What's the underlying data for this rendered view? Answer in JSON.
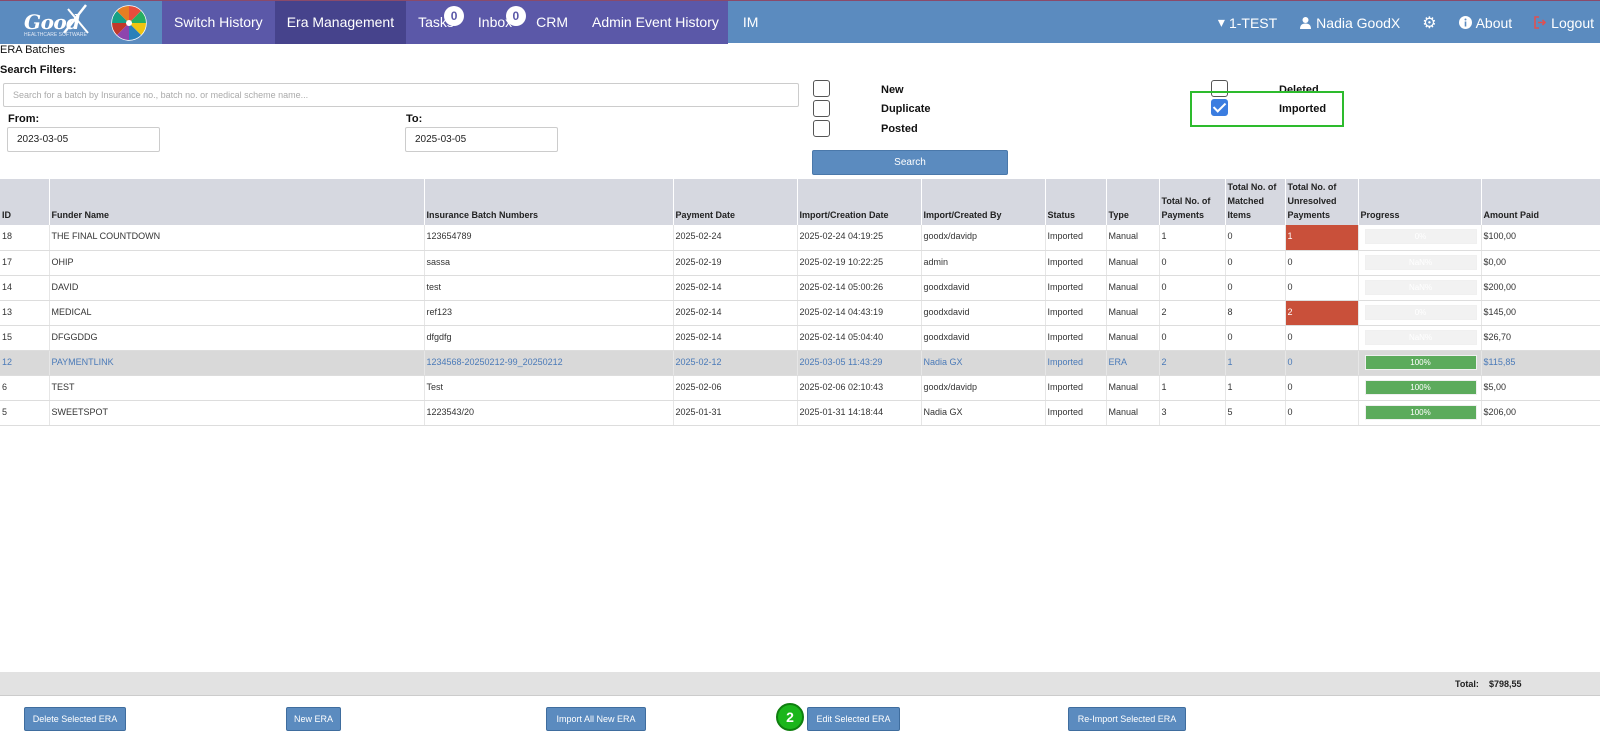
{
  "nav": {
    "logo_text": "Good",
    "logo_sub": "HEALTHCARE SOFTWARE",
    "items": [
      {
        "label": "Switch History"
      },
      {
        "label": "Era Management"
      },
      {
        "label": "Tasks",
        "badge": "0"
      },
      {
        "label": "Inbox",
        "badge": "0"
      },
      {
        "label": "CRM"
      },
      {
        "label": "Admin Event History"
      },
      {
        "label": "IM"
      }
    ],
    "right": {
      "practice": "1-TEST",
      "user": "Nadia GoodX",
      "about": "About",
      "logout": "Logout"
    },
    "colors": {
      "bar": "#5b8bbf",
      "menu": "#5b58a8",
      "active": "#46438c"
    }
  },
  "page": {
    "title": "ERA Batches",
    "filters_label": "Search Filters:",
    "search_placeholder": "Search for a batch by Insurance no., batch no. or medical scheme name...",
    "from_label": "From:",
    "from_value": "2023-03-05",
    "to_label": "To:",
    "to_value": "2025-03-05",
    "statuses": {
      "new": {
        "label": "New",
        "checked": false
      },
      "duplicate": {
        "label": "Duplicate",
        "checked": false
      },
      "posted": {
        "label": "Posted",
        "checked": false
      },
      "deleted": {
        "label": "Deleted",
        "checked": false
      },
      "imported": {
        "label": "Imported",
        "checked": true
      }
    },
    "search_button": "Search"
  },
  "table": {
    "headers": [
      "ID",
      "Funder Name",
      "Insurance Batch Numbers",
      "Payment Date",
      "Import/Creation Date",
      "Import/Created By",
      "Status",
      "Type",
      "Total No. of Payments",
      "Total No. of Matched Items",
      "Total No. of Unresolved Payments",
      "Progress",
      "Amount Paid"
    ],
    "rows": [
      {
        "id": "18",
        "funder": "THE FINAL COUNTDOWN",
        "batch": "123654789",
        "payment_date": "2025-02-24",
        "created": "2025-02-24 04:19:25",
        "created_by": "goodx/davidp",
        "status": "Imported",
        "type": "Manual",
        "payments": "1",
        "matched": "0",
        "unresolved": "1",
        "unresolved_flag": true,
        "progress": 0,
        "progress_label": "0%",
        "amount": "$100,00"
      },
      {
        "id": "17",
        "funder": "OHIP",
        "batch": "sassa",
        "payment_date": "2025-02-19",
        "created": "2025-02-19 10:22:25",
        "created_by": "admin",
        "status": "Imported",
        "type": "Manual",
        "payments": "0",
        "matched": "0",
        "unresolved": "0",
        "unresolved_flag": false,
        "progress": 0,
        "progress_label": "NaN%",
        "amount": "$0,00"
      },
      {
        "id": "14",
        "funder": "DAVID",
        "batch": "test",
        "payment_date": "2025-02-14",
        "created": "2025-02-14 05:00:26",
        "created_by": "goodxdavid",
        "status": "Imported",
        "type": "Manual",
        "payments": "0",
        "matched": "0",
        "unresolved": "0",
        "unresolved_flag": false,
        "progress": 0,
        "progress_label": "NaN%",
        "amount": "$200,00"
      },
      {
        "id": "13",
        "funder": "MEDICAL",
        "batch": "ref123",
        "payment_date": "2025-02-14",
        "created": "2025-02-14 04:43:19",
        "created_by": "goodxdavid",
        "status": "Imported",
        "type": "Manual",
        "payments": "2",
        "matched": "8",
        "unresolved": "2",
        "unresolved_flag": true,
        "progress": 0,
        "progress_label": "0%",
        "amount": "$145,00"
      },
      {
        "id": "15",
        "funder": "DFGGDDG",
        "batch": "dfgdfg",
        "payment_date": "2025-02-14",
        "created": "2025-02-14 05:04:40",
        "created_by": "goodxdavid",
        "status": "Imported",
        "type": "Manual",
        "payments": "0",
        "matched": "0",
        "unresolved": "0",
        "unresolved_flag": false,
        "progress": 0,
        "progress_label": "NaN%",
        "amount": "$26,70"
      },
      {
        "id": "12",
        "funder": "PAYMENTLINK",
        "batch": "1234568-20250212-99_20250212",
        "payment_date": "2025-02-12",
        "created": "2025-03-05 11:43:29",
        "created_by": "Nadia GX",
        "status": "Imported",
        "type": "ERA",
        "payments": "2",
        "matched": "1",
        "unresolved": "0",
        "unresolved_flag": false,
        "progress": 100,
        "progress_label": "100%",
        "amount": "$115,85",
        "selected": true
      },
      {
        "id": "6",
        "funder": "TEST",
        "batch": "Test",
        "payment_date": "2025-02-06",
        "created": "2025-02-06 02:10:43",
        "created_by": "goodx/davidp",
        "status": "Imported",
        "type": "Manual",
        "payments": "1",
        "matched": "1",
        "unresolved": "0",
        "unresolved_flag": false,
        "progress": 100,
        "progress_label": "100%",
        "amount": "$5,00"
      },
      {
        "id": "5",
        "funder": "SWEETSPOT",
        "batch": "1223543/20",
        "payment_date": "2025-01-31",
        "created": "2025-01-31 14:18:44",
        "created_by": "Nadia GX",
        "status": "Imported",
        "type": "Manual",
        "payments": "3",
        "matched": "5",
        "unresolved": "0",
        "unresolved_flag": false,
        "progress": 100,
        "progress_label": "100%",
        "amount": "$206,00"
      }
    ],
    "total_label": "Total:",
    "total_value": "$798,55"
  },
  "footer": {
    "delete_btn": "Delete Selected ERA",
    "new_btn": "New ERA",
    "import_all_btn": "Import All New ERA",
    "edit_btn": "Edit Selected ERA",
    "reimport_btn": "Re-Import Selected ERA",
    "step_badge": "2"
  }
}
